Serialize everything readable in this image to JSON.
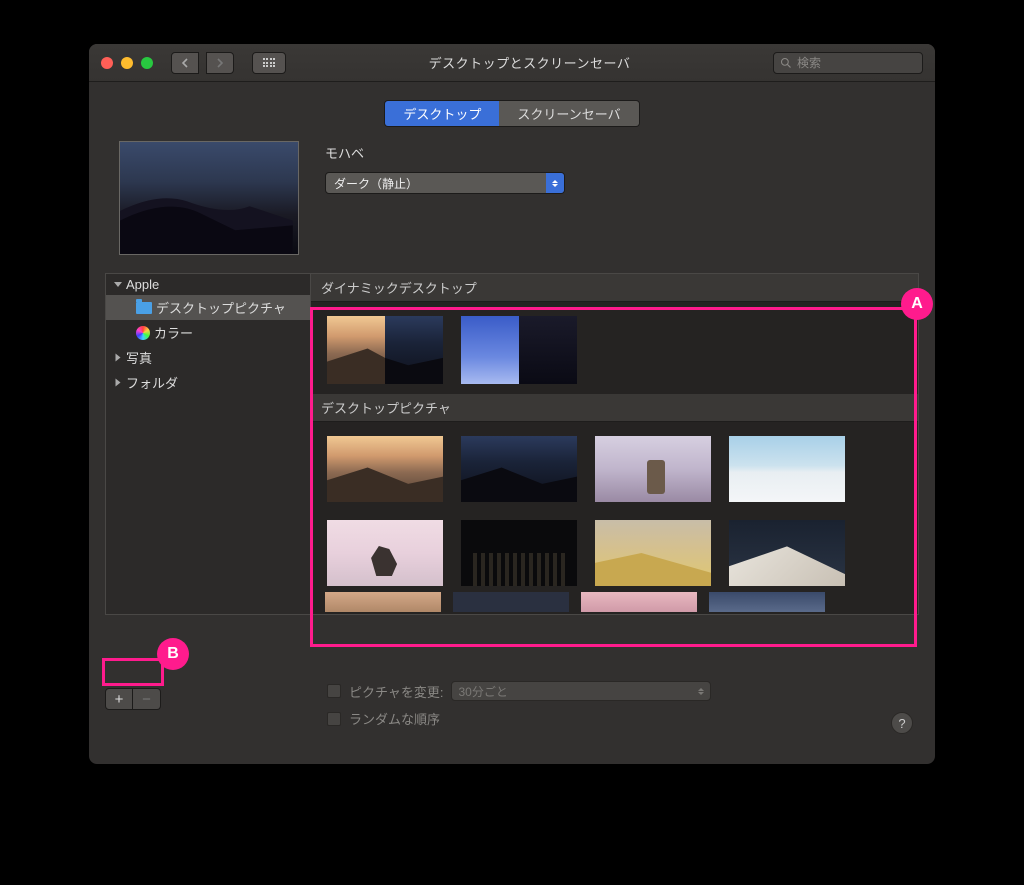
{
  "window": {
    "title": "デスクトップとスクリーンセーバ",
    "search_placeholder": "検索"
  },
  "tabs": {
    "desktop": "デスクトップ",
    "screensaver": "スクリーンセーバ",
    "active": "desktop"
  },
  "current": {
    "name": "モハベ",
    "mode": "ダーク（静止）"
  },
  "sidebar": {
    "apple": "Apple",
    "desktop_pictures": "デスクトップピクチャ",
    "colors": "カラー",
    "photos": "写真",
    "folders": "フォルダ"
  },
  "gallery": {
    "dynamic_header": "ダイナミックデスクトップ",
    "pictures_header": "デスクトップピクチャ"
  },
  "options": {
    "change_label": "ピクチャを変更:",
    "interval": "30分ごと",
    "random_label": "ランダムな順序"
  },
  "annotations": {
    "a": "A",
    "b": "B"
  },
  "colors": {
    "accent": "#3a6fd8",
    "annotation": "#ff1b8d"
  }
}
